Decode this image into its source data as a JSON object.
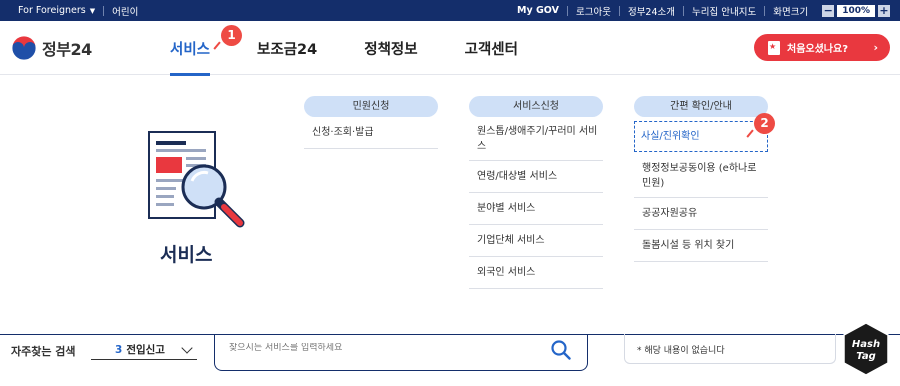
{
  "topbar": {
    "left": [
      "For Foreigners",
      "어린이"
    ],
    "right": [
      "My GOV",
      "로그아웃",
      "정부24소개",
      "누리집 안내지도",
      "화면크기"
    ],
    "zoom_minus": "−",
    "zoom_value": "100%",
    "zoom_plus": "+"
  },
  "logo": {
    "text": "정부24"
  },
  "gnb": {
    "items": [
      "서비스",
      "보조금24",
      "정책정보",
      "고객센터"
    ],
    "active": "서비스"
  },
  "first_visit": {
    "label": "처음오셨나요?",
    "arrow": "›"
  },
  "badges": [
    "1",
    "2"
  ],
  "panel": {
    "title": "서비스",
    "columns": [
      {
        "head": "민원신청",
        "links": [
          "신청·조회·발급"
        ]
      },
      {
        "head": "서비스신청",
        "links": [
          "원스톱/생애주기/꾸러미 서비스",
          "연령/대상별 서비스",
          "분야별 서비스",
          "기업단체 서비스",
          "외국인 서비스"
        ]
      },
      {
        "head": "간편 확인/안내",
        "links": [
          "사실/진위확인",
          "행정정보공동이용 (e하나로민원)",
          "공공자원공유",
          "돌봄시설 등 위치 찾기"
        ]
      }
    ]
  },
  "bottom": {
    "label": "자주찾는 검색",
    "freq_num": "3",
    "freq_text": "전입신고",
    "search_placeholder": "찾으시는 서비스를 입력하세요",
    "result": "* 해당 내용이 없습니다"
  },
  "watermark": {
    "line1": "Hash",
    "line2": "Tag"
  },
  "colors": {
    "navy": "#142e6b",
    "accent_blue": "#2465c8",
    "red": "#e9383f",
    "pill": "#cfe0f7"
  }
}
